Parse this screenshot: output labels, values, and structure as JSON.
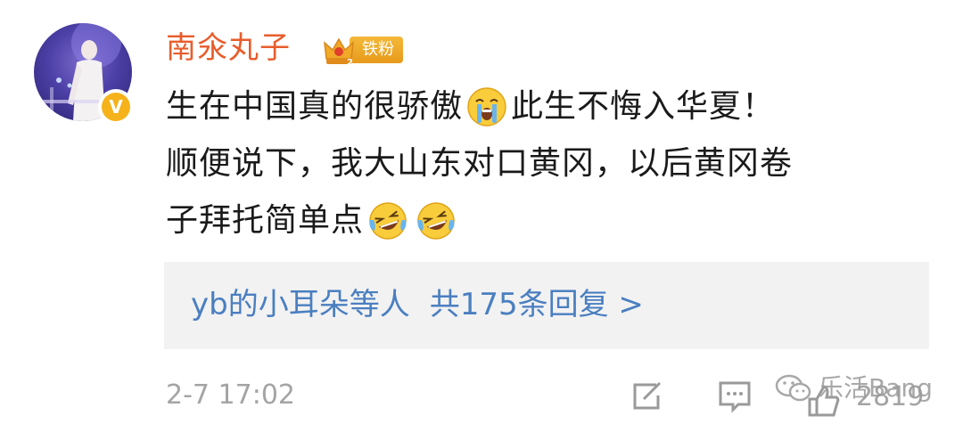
{
  "comment": {
    "username": "南氽丸子",
    "fan_badge": "铁粉",
    "verified_mark": "V",
    "lines": [
      {
        "before": "生在中国真的很骄傲",
        "after": "此生不悔入华夏！"
      },
      {
        "text": "顺便说下，我大山东对口黄冈，以后黄冈卷"
      },
      {
        "text": "子拜托简单点"
      }
    ],
    "emoji_icons": [
      "crying-face-icon",
      "laughing-tears-icon",
      "laughing-tears-icon"
    ]
  },
  "replies": {
    "prefix": "yb的小耳朵等人",
    "summary": "共175条回复 >"
  },
  "footer": {
    "time": "2-7 17:02",
    "like_count": "2819"
  },
  "watermark": {
    "text": "乐活Bang"
  },
  "colors": {
    "username": "#e85d2c",
    "link": "#4a7fc1",
    "meta": "#a4a4a4",
    "badge": "#f0a928",
    "reply_bg": "#f2f2f2"
  }
}
